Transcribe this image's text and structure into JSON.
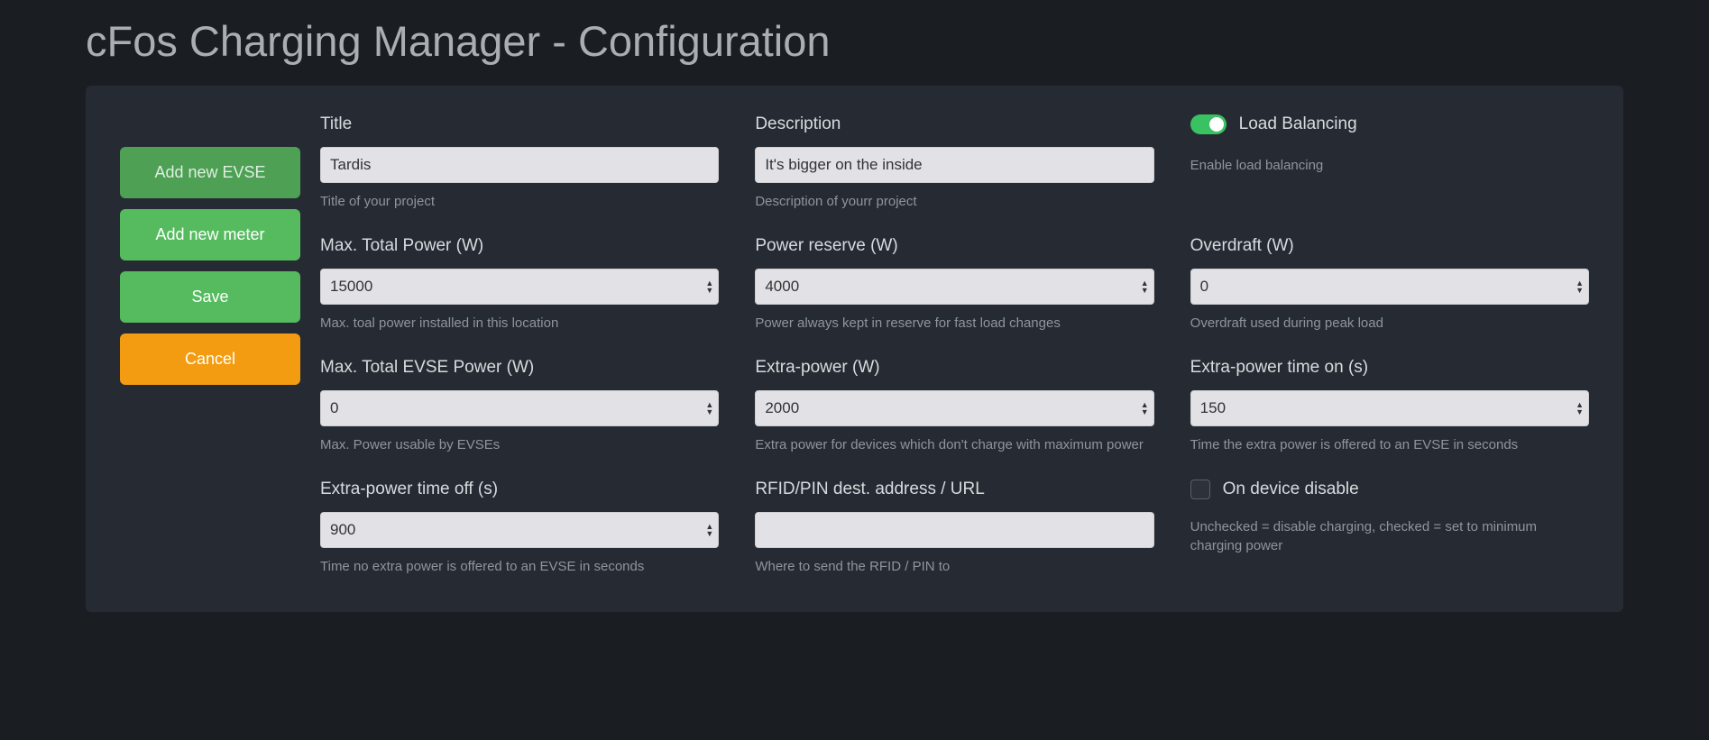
{
  "page": {
    "title": "cFos Charging Manager - Configuration"
  },
  "sidebar": {
    "add_evse": "Add new EVSE",
    "add_meter": "Add new meter",
    "save": "Save",
    "cancel": "Cancel"
  },
  "fields": {
    "title": {
      "label": "Title",
      "value": "Tardis",
      "help": "Title of your project"
    },
    "description": {
      "label": "Description",
      "value": "It's bigger on the inside",
      "help": "Description of yourr project"
    },
    "load_balancing": {
      "label": "Load Balancing",
      "help": "Enable load balancing",
      "on": true
    },
    "max_total_power": {
      "label": "Max. Total Power (W)",
      "value": "15000",
      "help": "Max. toal power installed in this location"
    },
    "power_reserve": {
      "label": "Power reserve (W)",
      "value": "4000",
      "help": "Power always kept in reserve for fast load changes"
    },
    "overdraft": {
      "label": "Overdraft (W)",
      "value": "0",
      "help": "Overdraft used during peak load"
    },
    "max_evse_power": {
      "label": "Max. Total EVSE Power (W)",
      "value": "0",
      "help": "Max. Power usable by EVSEs"
    },
    "extra_power": {
      "label": "Extra-power (W)",
      "value": "2000",
      "help": "Extra power for devices which don't charge with maximum power"
    },
    "extra_power_time_on": {
      "label": "Extra-power time on (s)",
      "value": "150",
      "help": "Time the extra power is offered to an EVSE in seconds"
    },
    "extra_power_time_off": {
      "label": "Extra-power time off (s)",
      "value": "900",
      "help": "Time no extra power is offered to an EVSE in seconds"
    },
    "rfid_url": {
      "label": "RFID/PIN dest. address / URL",
      "value": "",
      "help": "Where to send the RFID / PIN to"
    },
    "on_device_disable": {
      "label": "On device disable",
      "help": "Unchecked = disable charging, checked = set to minimum charging power",
      "checked": false
    }
  }
}
